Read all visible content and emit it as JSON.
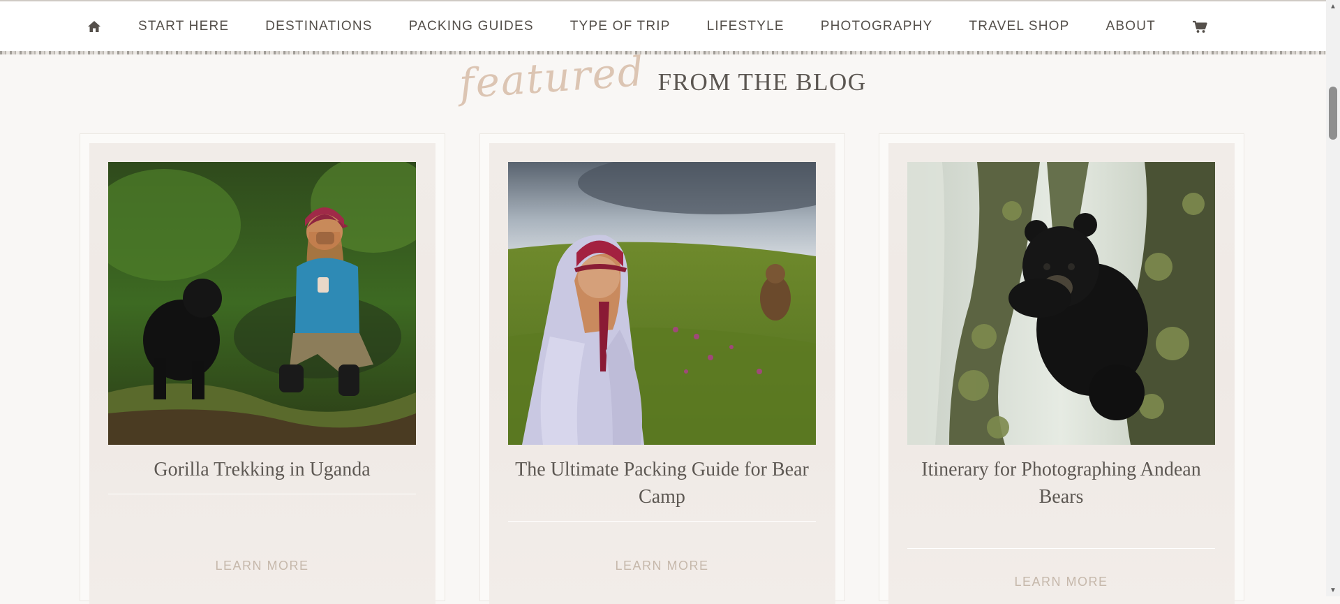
{
  "nav": {
    "home_icon": "home-icon",
    "items": [
      {
        "label": "START HERE"
      },
      {
        "label": "DESTINATIONS"
      },
      {
        "label": "PACKING GUIDES"
      },
      {
        "label": "TYPE OF TRIP"
      },
      {
        "label": "LIFESTYLE"
      },
      {
        "label": "PHOTOGRAPHY"
      },
      {
        "label": "TRAVEL SHOP"
      },
      {
        "label": "ABOUT"
      }
    ],
    "cart_icon": "shopping-cart-icon"
  },
  "section": {
    "script_text": "featured",
    "title": "FROM THE BLOG"
  },
  "cards": [
    {
      "title": "Gorilla Trekking in Uganda",
      "link": "LEARN MORE"
    },
    {
      "title": "The Ultimate Packing Guide  for Bear Camp",
      "link": "LEARN MORE"
    },
    {
      "title": "Itinerary  for Photographing Andean Bears",
      "link": "LEARN MORE"
    }
  ],
  "colors": {
    "page_bg": "#f9f7f5",
    "nav_text": "#55504b",
    "heading_script": "#dcc5b3",
    "heading_text": "#5b5651",
    "card_bg": "#f1ece8",
    "link_text": "#c6b8ab"
  }
}
